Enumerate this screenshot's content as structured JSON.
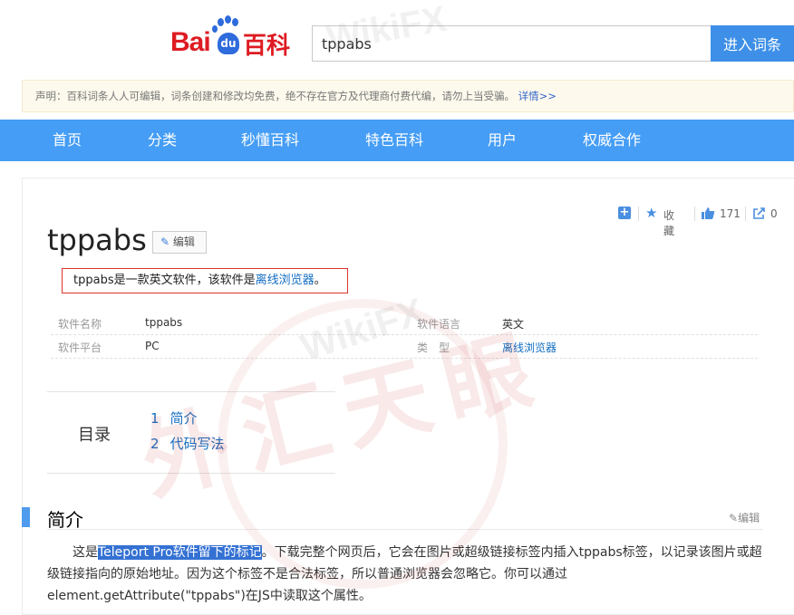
{
  "logo": {
    "bai": "Bai",
    "du": "du",
    "baike": "百科"
  },
  "search": {
    "value": "tppabs",
    "button": "进入词条"
  },
  "notice": {
    "text": "声明：百科词条人人可编辑，词条创建和修改均免费，绝不存在官方及代理商付费代编，请勿上当受骗。",
    "link": "详情>>"
  },
  "nav": [
    "首页",
    "分类",
    "秒懂百科",
    "特色百科",
    "用户",
    "权威合作"
  ],
  "topbar": {
    "favorite": "收藏",
    "likes": "171",
    "shares": "0"
  },
  "entry": {
    "title": "tppabs",
    "edit_label": "编辑",
    "summary_pre": "tppabs是一款英文软件，该软件是",
    "summary_link": "离线浏览器",
    "summary_post": "。"
  },
  "infobox": {
    "left": [
      {
        "label": "软件名称",
        "value": "tppabs"
      },
      {
        "label": "软件平台",
        "value": "PC"
      }
    ],
    "right": [
      {
        "label": "软件语言",
        "value": "英文"
      },
      {
        "label": "类　型",
        "value": "离线浏览器"
      }
    ]
  },
  "toc": {
    "label": "目录",
    "items": [
      {
        "num": "1",
        "text": "简介"
      },
      {
        "num": "2",
        "text": "代码写法"
      }
    ]
  },
  "section": {
    "title": "简介",
    "edit_label": "编辑",
    "para_pre": "这是",
    "para_highlight": "Teleport Pro软件留下的标记",
    "para_post": "。下载完整个网页后，它会在图片或超级链接标签内插入tppabs标签，以记录该图片或超级链接指向的原始地址。因为这个标签不是合法标签，所以普通浏览器会忽略它。你可以通过element.getAttribute(\"tppabs\")在JS中读取这个属性。"
  },
  "watermark": {
    "brand": "WikiFX",
    "stamp": "外汇天眼"
  },
  "colors": {
    "accent": "#459df5",
    "logo_red": "#de1b22",
    "logo_blue": "#2e6bdc",
    "link": "#136ec2",
    "summary_border": "#d9342b"
  }
}
